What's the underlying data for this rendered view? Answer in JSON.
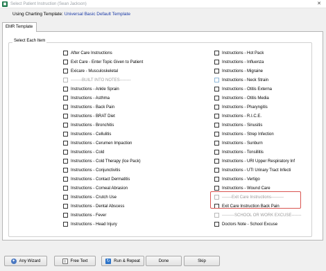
{
  "window": {
    "title": "Select Patient Instruction (Sean Jackson)",
    "close_glyph": "✕"
  },
  "template": {
    "label": "Using Charting Template:",
    "value": "Universal Basic Default Template"
  },
  "tab": {
    "label": "EMR Template"
  },
  "group": {
    "legend": "Select Each Item"
  },
  "left_items": [
    {
      "label": "After Care Instructions"
    },
    {
      "label": "Exit Care - Enter Topic Given to Patient"
    },
    {
      "label": "Exicare - Musculoskeletal"
    },
    {
      "label": "--------BUILT INTO NOTES--------"
    },
    {
      "label": "Instructions - Ankle Sprain"
    },
    {
      "label": "Instructions - Asthma"
    },
    {
      "label": "Instructions - Back Pain"
    },
    {
      "label": "Instructions - BRAT Diet"
    },
    {
      "label": "Instructions - Bronchitis"
    },
    {
      "label": "Instructions - Cellulitis"
    },
    {
      "label": "Instructions - Cerumen Impaction"
    },
    {
      "label": "Instructions - Cold"
    },
    {
      "label": "Instructions - Cold Therapy (Ice Pack)"
    },
    {
      "label": "Instructions - Conjunctivitis"
    },
    {
      "label": "Instructions - Contact Dermatitis"
    },
    {
      "label": "Instructions - Corneal Abrasion"
    },
    {
      "label": "Instructions - Crutch Use"
    },
    {
      "label": "Instructions - Dental Abscess"
    },
    {
      "label": "Instructions - Fever"
    },
    {
      "label": "Instructions - Head Injury"
    }
  ],
  "right_items": [
    {
      "label": "Instructions - Hot Pack"
    },
    {
      "label": "Instructions - Influenza"
    },
    {
      "label": "Instructions - Migraine"
    },
    {
      "label": "Instructions - Neck Strain"
    },
    {
      "label": "Instructions - Otitis Externa"
    },
    {
      "label": "Instructions - Otitis Media"
    },
    {
      "label": "Instructions - Pharyngitis"
    },
    {
      "label": "Instructions - R.I.C.E."
    },
    {
      "label": "Instructions - Sinusitis"
    },
    {
      "label": "Instructions - Strep Infection"
    },
    {
      "label": "Instructions - Sunburn"
    },
    {
      "label": "Instructions - Tonsillitis"
    },
    {
      "label": "Instructions - URI Upper Respiratory Inf"
    },
    {
      "label": "Instructions - UTI Urinary Tract Infecti"
    },
    {
      "label": "Instructions - Vertigo"
    },
    {
      "label": "Instructions - Wound Care"
    },
    {
      "label": "-------Exit Care Instructions---------"
    },
    {
      "label": "Exit Care  Instruction Back Pain"
    },
    {
      "label": "---------SCHOOL OR WORK EXCUSE-------"
    },
    {
      "label": "Doctors Note - School Excuse"
    }
  ],
  "footer": {
    "any_wizard": "Any Wizard",
    "free_text": "Free Text",
    "run_repeat": "Run & Repeat",
    "done": "Done",
    "skip": "Skip"
  }
}
